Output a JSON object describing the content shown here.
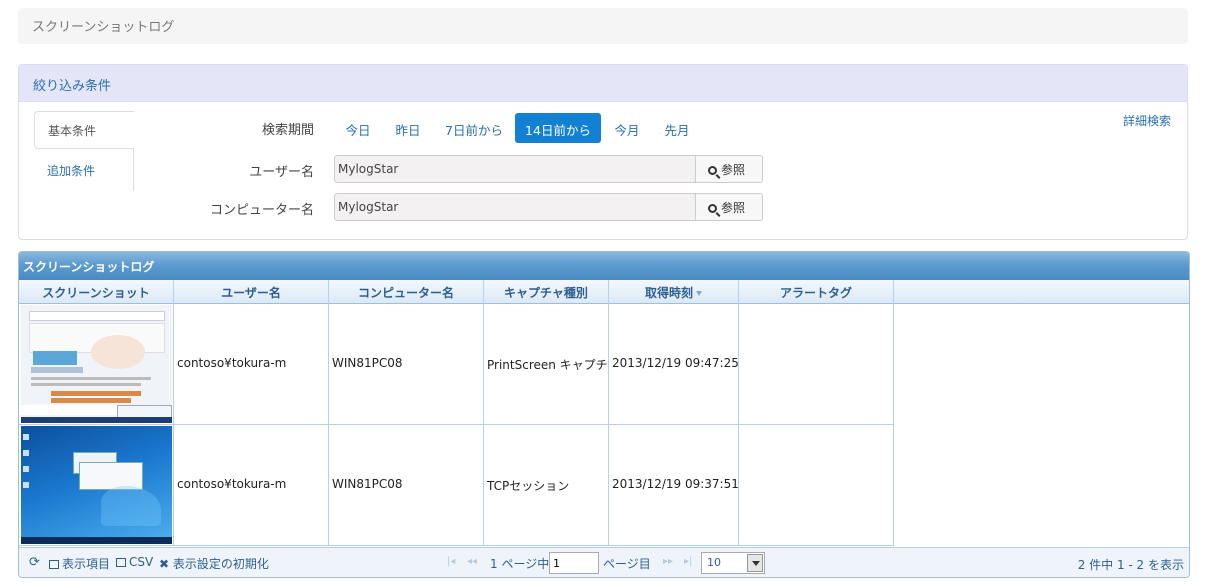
{
  "page": {
    "title": "スクリーンショットログ"
  },
  "filter": {
    "heading": "絞り込み条件",
    "tabs": [
      "基本条件",
      "追加条件"
    ],
    "advanced_link": "詳細検索",
    "period_label": "検索期間",
    "period_options": [
      "今日",
      "昨日",
      "7日前から",
      "14日前から",
      "今月",
      "先月"
    ],
    "period_selected": "14日前から",
    "user_label": "ユーザー名",
    "user_value": "MylogStar",
    "computer_label": "コンピューター名",
    "computer_value": "MylogStar",
    "browse_label": "参照"
  },
  "grid": {
    "caption": "スクリーンショットログ",
    "columns": [
      "スクリーンショット",
      "ユーザー名",
      "コンピューター名",
      "キャプチャ種別",
      "取得時刻",
      "アラートタグ"
    ],
    "rows": [
      {
        "user": "contoso¥tokura-m",
        "computer": "WIN81PC08",
        "capture_type": "PrintScreen キャプチャ",
        "time": "2013/12/19 09:47:25",
        "alert": ""
      },
      {
        "user": "contoso¥tokura-m",
        "computer": "WIN81PC08",
        "capture_type": "TCPセッション",
        "time": "2013/12/19 09:37:51",
        "alert": ""
      }
    ],
    "footer": {
      "columns_label": "表示項目",
      "csv_label": "CSV",
      "reset_label": "表示設定の初期化",
      "page_prefix": "1 ページ中",
      "page_value": "1",
      "page_suffix": "ページ目",
      "page_size": "10",
      "record_info": "2 件中 1 - 2 を表示"
    }
  }
}
